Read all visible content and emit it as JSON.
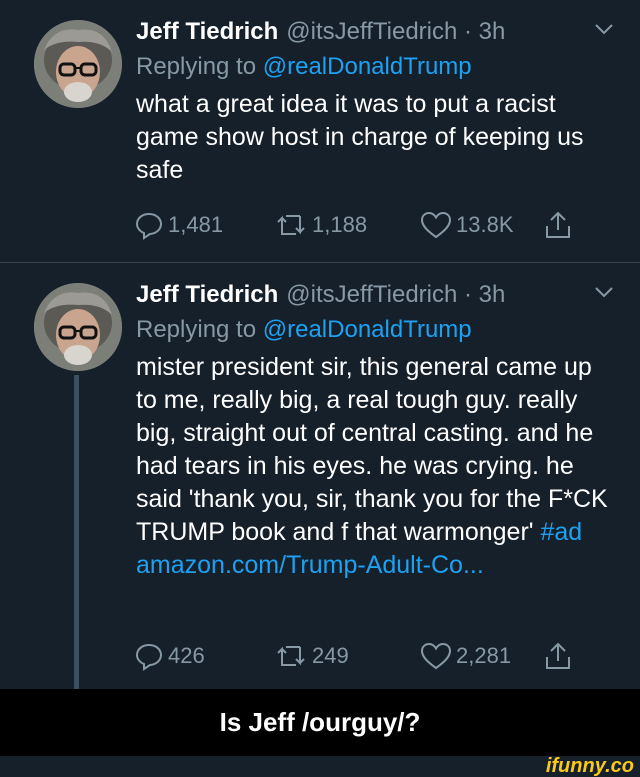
{
  "tweets": [
    {
      "name": "Jeff Tiedrich",
      "handle": "@itsJeffTiedrich · 3h",
      "replying_prefix": "Replying to ",
      "replying_to": "@realDonaldTrump",
      "text": "what a great idea it was to put a racist game show host in charge of keeping us safe",
      "replies": "1,481",
      "retweets": "1,188",
      "likes": "13.8K"
    },
    {
      "name": "Jeff Tiedrich",
      "handle": "@itsJeffTiedrich · 3h",
      "replying_prefix": "Replying to ",
      "replying_to": "@realDonaldTrump",
      "text": "mister president sir, this general came up to me, really big, a real tough guy. really big, straight out of central casting. and he had tears in his eyes. he was crying. he said 'thank you, sir, thank you for the F*CK TRUMP book and f that warmonger' ",
      "hashtag": "#ad",
      "link": "amazon.com/Trump-Adult-Co...",
      "replies": "426",
      "retweets": "249",
      "likes": "2,281"
    }
  ],
  "caption": "Is Jeff /ourguy/?",
  "watermark": "ifunny.co",
  "colors": {
    "background": "#15202b",
    "secondary_text": "#8899a6",
    "link": "#1da1f2",
    "divider": "#38444d",
    "watermark": "#fbc91a"
  },
  "icons": [
    "chevron-down-icon",
    "reply-icon",
    "retweet-icon",
    "like-icon",
    "share-icon"
  ]
}
